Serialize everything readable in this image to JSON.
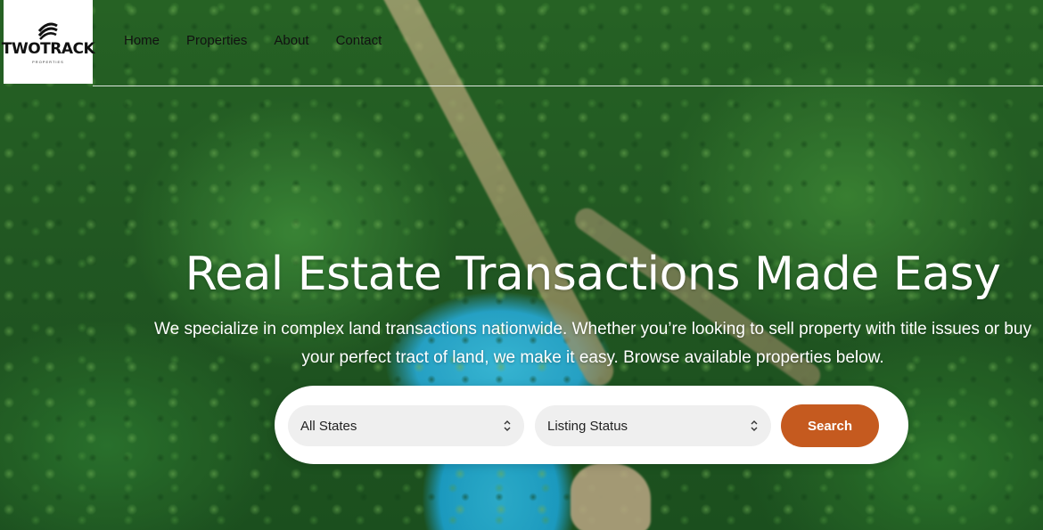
{
  "brand": {
    "name": "TWOTRACK",
    "tagline": "PROPERTIES"
  },
  "nav": {
    "items": [
      "Home",
      "Properties",
      "About",
      "Contact"
    ]
  },
  "hero": {
    "title": "Real Estate Transactions Made Easy",
    "subtitle": "We specialize in complex land transactions nationwide. Whether you’re looking to sell property with title issues or buy your perfect tract of land, we make it easy. Browse available properties below."
  },
  "search": {
    "state_select": "All States",
    "status_select": "Listing Status",
    "button_label": "Search"
  },
  "colors": {
    "accent": "#c55a1f",
    "select_bg": "#efefef",
    "logo_bg": "#ffffff"
  },
  "icons": {
    "logo": "twotrack-logo-icon",
    "select_chevron": "chevron-updown-icon"
  }
}
